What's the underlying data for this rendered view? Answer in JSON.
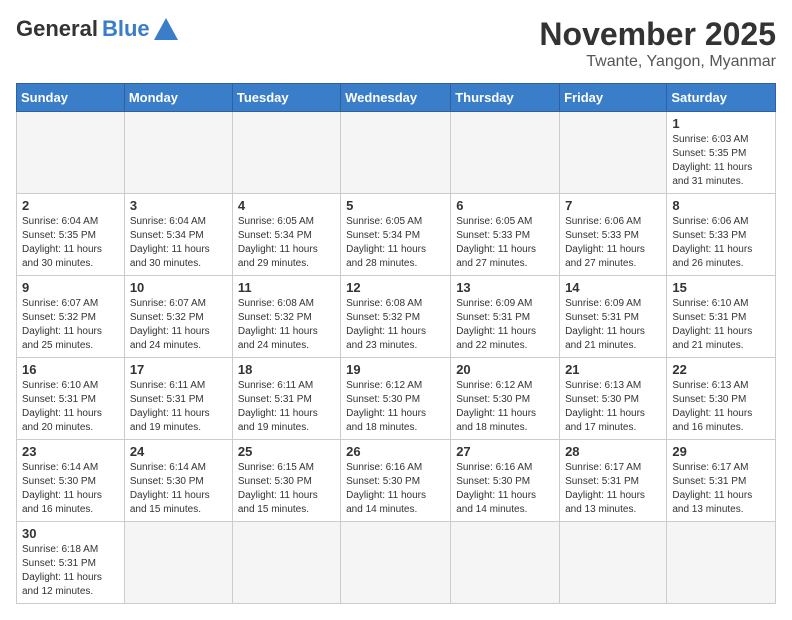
{
  "header": {
    "logo_general": "General",
    "logo_blue": "Blue",
    "month_title": "November 2025",
    "location": "Twante, Yangon, Myanmar"
  },
  "days_of_week": [
    "Sunday",
    "Monday",
    "Tuesday",
    "Wednesday",
    "Thursday",
    "Friday",
    "Saturday"
  ],
  "weeks": [
    [
      {
        "day": "",
        "info": ""
      },
      {
        "day": "",
        "info": ""
      },
      {
        "day": "",
        "info": ""
      },
      {
        "day": "",
        "info": ""
      },
      {
        "day": "",
        "info": ""
      },
      {
        "day": "",
        "info": ""
      },
      {
        "day": "1",
        "info": "Sunrise: 6:03 AM\nSunset: 5:35 PM\nDaylight: 11 hours\nand 31 minutes."
      }
    ],
    [
      {
        "day": "2",
        "info": "Sunrise: 6:04 AM\nSunset: 5:35 PM\nDaylight: 11 hours\nand 30 minutes."
      },
      {
        "day": "3",
        "info": "Sunrise: 6:04 AM\nSunset: 5:34 PM\nDaylight: 11 hours\nand 30 minutes."
      },
      {
        "day": "4",
        "info": "Sunrise: 6:05 AM\nSunset: 5:34 PM\nDaylight: 11 hours\nand 29 minutes."
      },
      {
        "day": "5",
        "info": "Sunrise: 6:05 AM\nSunset: 5:34 PM\nDaylight: 11 hours\nand 28 minutes."
      },
      {
        "day": "6",
        "info": "Sunrise: 6:05 AM\nSunset: 5:33 PM\nDaylight: 11 hours\nand 27 minutes."
      },
      {
        "day": "7",
        "info": "Sunrise: 6:06 AM\nSunset: 5:33 PM\nDaylight: 11 hours\nand 27 minutes."
      },
      {
        "day": "8",
        "info": "Sunrise: 6:06 AM\nSunset: 5:33 PM\nDaylight: 11 hours\nand 26 minutes."
      }
    ],
    [
      {
        "day": "9",
        "info": "Sunrise: 6:07 AM\nSunset: 5:32 PM\nDaylight: 11 hours\nand 25 minutes."
      },
      {
        "day": "10",
        "info": "Sunrise: 6:07 AM\nSunset: 5:32 PM\nDaylight: 11 hours\nand 24 minutes."
      },
      {
        "day": "11",
        "info": "Sunrise: 6:08 AM\nSunset: 5:32 PM\nDaylight: 11 hours\nand 24 minutes."
      },
      {
        "day": "12",
        "info": "Sunrise: 6:08 AM\nSunset: 5:32 PM\nDaylight: 11 hours\nand 23 minutes."
      },
      {
        "day": "13",
        "info": "Sunrise: 6:09 AM\nSunset: 5:31 PM\nDaylight: 11 hours\nand 22 minutes."
      },
      {
        "day": "14",
        "info": "Sunrise: 6:09 AM\nSunset: 5:31 PM\nDaylight: 11 hours\nand 21 minutes."
      },
      {
        "day": "15",
        "info": "Sunrise: 6:10 AM\nSunset: 5:31 PM\nDaylight: 11 hours\nand 21 minutes."
      }
    ],
    [
      {
        "day": "16",
        "info": "Sunrise: 6:10 AM\nSunset: 5:31 PM\nDaylight: 11 hours\nand 20 minutes."
      },
      {
        "day": "17",
        "info": "Sunrise: 6:11 AM\nSunset: 5:31 PM\nDaylight: 11 hours\nand 19 minutes."
      },
      {
        "day": "18",
        "info": "Sunrise: 6:11 AM\nSunset: 5:31 PM\nDaylight: 11 hours\nand 19 minutes."
      },
      {
        "day": "19",
        "info": "Sunrise: 6:12 AM\nSunset: 5:30 PM\nDaylight: 11 hours\nand 18 minutes."
      },
      {
        "day": "20",
        "info": "Sunrise: 6:12 AM\nSunset: 5:30 PM\nDaylight: 11 hours\nand 18 minutes."
      },
      {
        "day": "21",
        "info": "Sunrise: 6:13 AM\nSunset: 5:30 PM\nDaylight: 11 hours\nand 17 minutes."
      },
      {
        "day": "22",
        "info": "Sunrise: 6:13 AM\nSunset: 5:30 PM\nDaylight: 11 hours\nand 16 minutes."
      }
    ],
    [
      {
        "day": "23",
        "info": "Sunrise: 6:14 AM\nSunset: 5:30 PM\nDaylight: 11 hours\nand 16 minutes."
      },
      {
        "day": "24",
        "info": "Sunrise: 6:14 AM\nSunset: 5:30 PM\nDaylight: 11 hours\nand 15 minutes."
      },
      {
        "day": "25",
        "info": "Sunrise: 6:15 AM\nSunset: 5:30 PM\nDaylight: 11 hours\nand 15 minutes."
      },
      {
        "day": "26",
        "info": "Sunrise: 6:16 AM\nSunset: 5:30 PM\nDaylight: 11 hours\nand 14 minutes."
      },
      {
        "day": "27",
        "info": "Sunrise: 6:16 AM\nSunset: 5:30 PM\nDaylight: 11 hours\nand 14 minutes."
      },
      {
        "day": "28",
        "info": "Sunrise: 6:17 AM\nSunset: 5:31 PM\nDaylight: 11 hours\nand 13 minutes."
      },
      {
        "day": "29",
        "info": "Sunrise: 6:17 AM\nSunset: 5:31 PM\nDaylight: 11 hours\nand 13 minutes."
      }
    ],
    [
      {
        "day": "30",
        "info": "Sunrise: 6:18 AM\nSunset: 5:31 PM\nDaylight: 11 hours\nand 12 minutes."
      },
      {
        "day": "",
        "info": ""
      },
      {
        "day": "",
        "info": ""
      },
      {
        "day": "",
        "info": ""
      },
      {
        "day": "",
        "info": ""
      },
      {
        "day": "",
        "info": ""
      },
      {
        "day": "",
        "info": ""
      }
    ]
  ]
}
